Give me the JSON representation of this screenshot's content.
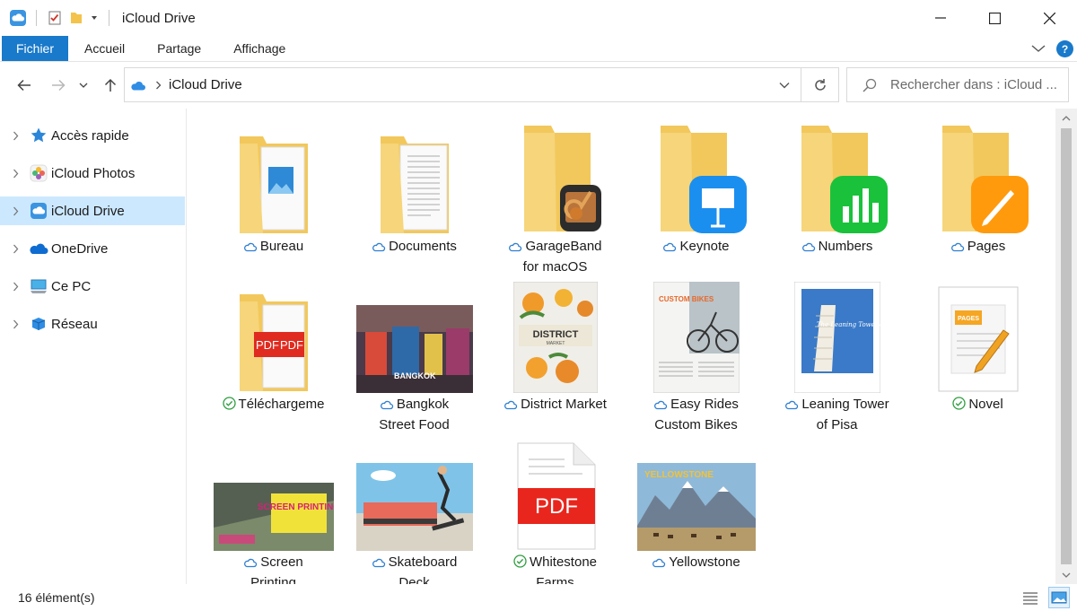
{
  "window": {
    "title": "iCloud Drive",
    "colors": {
      "accent": "#1979ca",
      "selection": "#cce8ff",
      "folder": "#f6d57b"
    }
  },
  "ribbon": {
    "tabs": [
      "Fichier",
      "Accueil",
      "Partage",
      "Affichage"
    ],
    "help": "?"
  },
  "address": {
    "path": "iCloud Drive",
    "search_placeholder": "Rechercher dans : iCloud ..."
  },
  "sidebar": {
    "items": [
      {
        "label": "Accès rapide",
        "icon": "star-icon"
      },
      {
        "label": "iCloud Photos",
        "icon": "photos-icon"
      },
      {
        "label": "iCloud Drive",
        "icon": "icloud-icon",
        "selected": true
      },
      {
        "label": "OneDrive",
        "icon": "onedrive-icon"
      },
      {
        "label": "Ce PC",
        "icon": "computer-icon"
      },
      {
        "label": "Réseau",
        "icon": "network-icon"
      }
    ]
  },
  "files": [
    {
      "line1": "Bureau",
      "line2": "",
      "status": "cloud",
      "kind": "folder-image"
    },
    {
      "line1": "Documents",
      "line2": "",
      "status": "cloud",
      "kind": "folder-doc"
    },
    {
      "line1": "GarageBand",
      "line2": "for macOS",
      "status": "cloud",
      "kind": "folder-garageband"
    },
    {
      "line1": "Keynote",
      "line2": "",
      "status": "cloud",
      "kind": "folder-keynote"
    },
    {
      "line1": "Numbers",
      "line2": "",
      "status": "cloud",
      "kind": "folder-numbers"
    },
    {
      "line1": "Pages",
      "line2": "",
      "status": "cloud",
      "kind": "folder-pages"
    },
    {
      "line1": "Téléchargeme",
      "line2": "",
      "status": "synced",
      "kind": "folder-pdf"
    },
    {
      "line1": "Bangkok",
      "line2": "Street Food",
      "status": "cloud",
      "kind": "photo-bangkok",
      "thumb_text": "BANGKOK"
    },
    {
      "line1": "District Market",
      "line2": "",
      "status": "cloud",
      "kind": "doc-district",
      "thumb_text": "DISTRICT",
      "thumb_sub": "MARKET"
    },
    {
      "line1": "Easy Rides",
      "line2": "Custom Bikes",
      "status": "cloud",
      "kind": "doc-bikes",
      "thumb_text": "CUSTOM BIKES"
    },
    {
      "line1": "Leaning Tower",
      "line2": "of Pisa",
      "status": "cloud",
      "kind": "doc-pisa",
      "thumb_text": "The Leaning Tower of Pisa"
    },
    {
      "line1": "Novel",
      "line2": "",
      "status": "synced",
      "kind": "pages-doc",
      "thumb_text": "PAGES"
    },
    {
      "line1": "Screen",
      "line2": "Printing",
      "status": "cloud",
      "kind": "photo-screen",
      "thumb_text": "SCREEN PRINTING"
    },
    {
      "line1": "Skateboard",
      "line2": "Deck",
      "status": "cloud",
      "kind": "photo-skate"
    },
    {
      "line1": "Whitestone",
      "line2": "Farms",
      "status": "synced",
      "kind": "pdf-file",
      "thumb_text": "PDF"
    },
    {
      "line1": "Yellowstone",
      "line2": "",
      "status": "cloud",
      "kind": "photo-yellowstone",
      "thumb_text": "YELLOWSTONE"
    }
  ],
  "statusbar": {
    "count": "16 élément(s)"
  }
}
